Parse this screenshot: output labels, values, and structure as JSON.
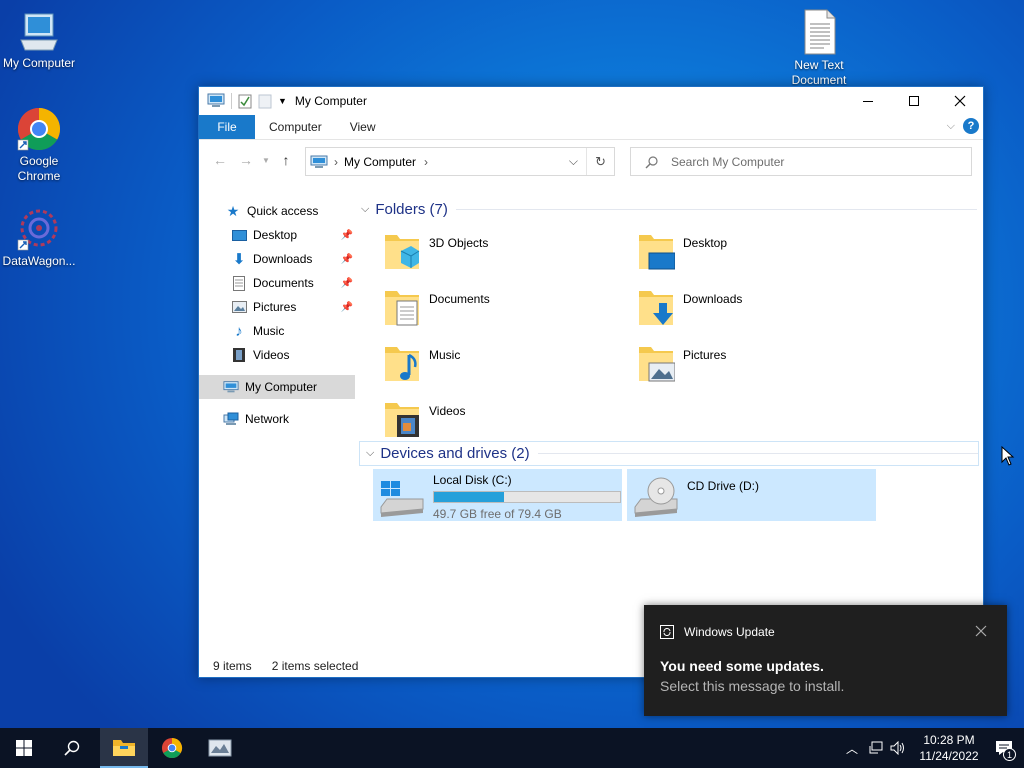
{
  "desktop": {
    "icons": [
      {
        "label": "My Computer"
      },
      {
        "label": "Google Chrome"
      },
      {
        "label": "DataWagon..."
      },
      {
        "label": "New Text Document"
      }
    ]
  },
  "window": {
    "title": "My Computer",
    "ribbon_tabs": [
      "File",
      "Computer",
      "View"
    ],
    "address": {
      "location": "My Computer"
    },
    "search": {
      "placeholder": "Search My Computer"
    },
    "sidebar": [
      {
        "label": "Quick access",
        "icon": "star-icon"
      },
      {
        "label": "Desktop",
        "icon": "desktop-icon",
        "pinned": true
      },
      {
        "label": "Downloads",
        "icon": "download-icon",
        "pinned": true
      },
      {
        "label": "Documents",
        "icon": "document-icon",
        "pinned": true
      },
      {
        "label": "Pictures",
        "icon": "picture-icon",
        "pinned": true
      },
      {
        "label": "Music",
        "icon": "music-icon"
      },
      {
        "label": "Videos",
        "icon": "video-icon"
      },
      {
        "label": "My Computer",
        "icon": "computer-icon",
        "selected": true
      },
      {
        "label": "Network",
        "icon": "network-icon"
      }
    ],
    "folders_header": "Folders (7)",
    "folders": [
      {
        "label": "3D Objects"
      },
      {
        "label": "Desktop"
      },
      {
        "label": "Documents"
      },
      {
        "label": "Downloads"
      },
      {
        "label": "Music"
      },
      {
        "label": "Pictures"
      },
      {
        "label": "Videos"
      }
    ],
    "drives_header": "Devices and drives (2)",
    "drives": [
      {
        "label": "Local Disk (C:)",
        "free_text": "49.7 GB free of 79.4 GB",
        "used_fraction": 0.374
      },
      {
        "label": "CD Drive (D:)"
      }
    ],
    "status": {
      "items": "9 items",
      "selected": "2 items selected"
    }
  },
  "toast": {
    "app": "Windows Update",
    "heading": "You need some updates.",
    "body": "Select this message to install."
  },
  "taskbar": {
    "time": "10:28 PM",
    "date": "11/24/2022",
    "notification_count": "1"
  },
  "colors": {
    "accent": "#1979ca",
    "selection": "#cce8ff",
    "drive_bar": "#26a0da"
  }
}
